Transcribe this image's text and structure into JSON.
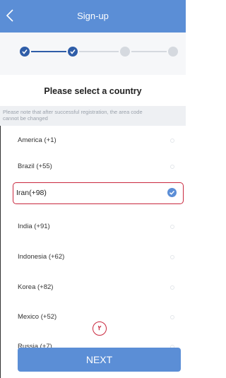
{
  "header": {
    "title": "Sign-up"
  },
  "stepper": {
    "steps": [
      "1",
      "2",
      "3",
      "4"
    ],
    "active_steps": 2
  },
  "heading": "Please select a country",
  "note": {
    "line1": "Please note that after successful registration, the area code",
    "line2": "cannot be changed"
  },
  "countries": [
    {
      "label": "America (+1)",
      "selected": false
    },
    {
      "label": "Brazil (+55)",
      "selected": false
    },
    {
      "label": "Iran(+98)",
      "selected": true
    },
    {
      "label": "India (+91)",
      "selected": false
    },
    {
      "label": "Indonesia (+62)",
      "selected": false
    },
    {
      "label": "Korea (+82)",
      "selected": false
    },
    {
      "label": "Mexico (+52)",
      "selected": false
    },
    {
      "label": "Russia (+7)",
      "selected": false
    }
  ],
  "annotation_marker": "٢",
  "next_button": "NEXT",
  "colors": {
    "primary": "#5b8ed6",
    "active_step": "#2f5da8",
    "highlight": "#c9283e"
  }
}
